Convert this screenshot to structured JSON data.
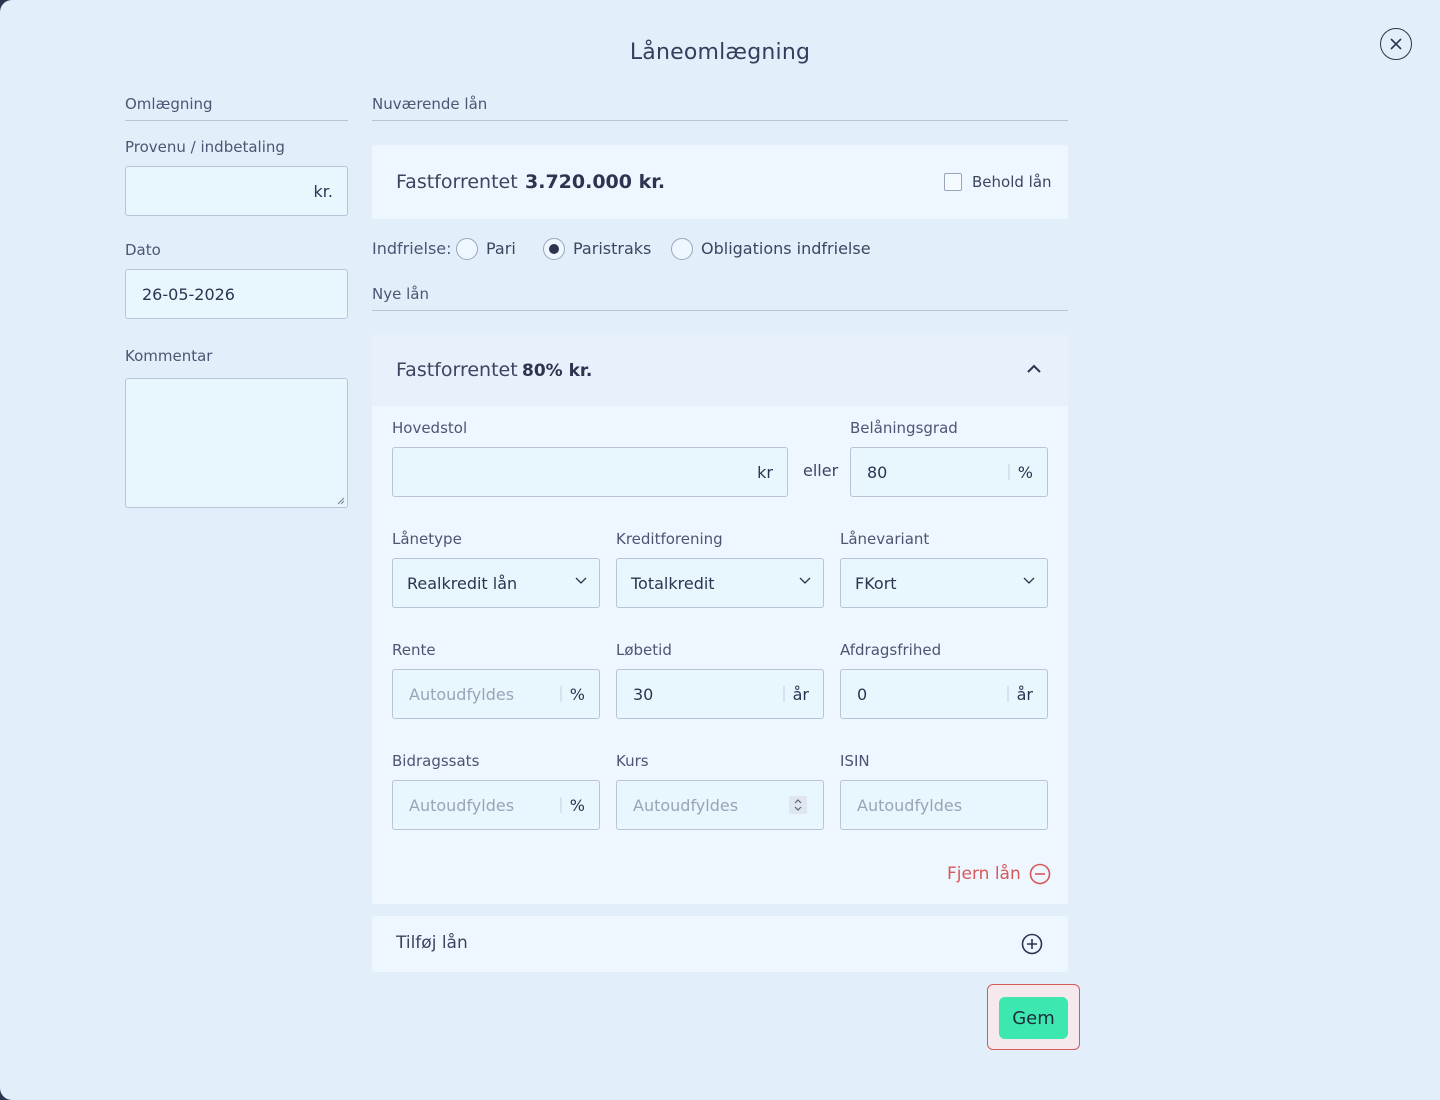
{
  "title": "Låneomlægning",
  "left": {
    "section_label": "Omlægning",
    "provenu": {
      "label": "Provenu / indbetaling",
      "value": "",
      "unit": "kr."
    },
    "dato": {
      "label": "Dato",
      "value": "26-05-2026"
    },
    "kommentar": {
      "label": "Kommentar",
      "value": ""
    }
  },
  "current": {
    "section_label": "Nuværende lån",
    "loan_type": "Fastforrentet",
    "amount": "3.720.000 kr.",
    "keep_label": "Behold lån",
    "keep_checked": false,
    "indfrielse_label": "Indfrielse:",
    "options": [
      {
        "label": "Pari",
        "selected": false
      },
      {
        "label": "Paristraks",
        "selected": true
      },
      {
        "label": "Obligations indfrielse",
        "selected": false
      }
    ]
  },
  "new_loans": {
    "section_label": "Nye lån",
    "loan": {
      "type_title": "Fastforrentet",
      "amount": "80% kr.",
      "hovedstol": {
        "label": "Hovedstol",
        "value": "",
        "unit": "kr"
      },
      "or_label": "eller",
      "belaaningsgrad": {
        "label": "Belåningsgrad",
        "value": "80",
        "unit": "%"
      },
      "laanetype": {
        "label": "Lånetype",
        "value": "Realkredit lån"
      },
      "kreditforening": {
        "label": "Kreditforening",
        "value": "Totalkredit"
      },
      "laanevariant": {
        "label": "Lånevariant",
        "value": "FKort"
      },
      "rente": {
        "label": "Rente",
        "placeholder": "Autoudfyldes",
        "unit": "%"
      },
      "loebetid": {
        "label": "Løbetid",
        "value": "30",
        "unit": "år"
      },
      "afdragsfrihed": {
        "label": "Afdragsfrihed",
        "value": "0",
        "unit": "år"
      },
      "bidragssats": {
        "label": "Bidragssats",
        "placeholder": "Autoudfyldes",
        "unit": "%"
      },
      "kurs": {
        "label": "Kurs",
        "placeholder": "Autoudfyldes"
      },
      "isin": {
        "label": "ISIN",
        "placeholder": "Autoudfyldes"
      },
      "remove_label": "Fjern lån"
    },
    "add_label": "Tilføj lån"
  },
  "save_label": "Gem",
  "colors": {
    "accent": "#3de8b0",
    "danger": "#d75858",
    "background": "#e3eefb",
    "text": "#2c3450"
  }
}
